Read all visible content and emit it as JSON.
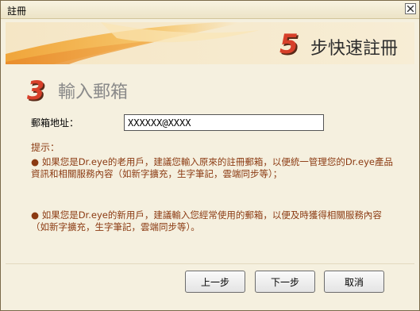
{
  "window": {
    "title": "註冊",
    "close_icon": "close-icon"
  },
  "banner": {
    "step_number": "5",
    "step_text": "步快速註冊"
  },
  "section": {
    "number": "3",
    "title": "輸入郵箱"
  },
  "form": {
    "email_label": "郵箱地址：",
    "email_value": "XXXXXX@XXXX"
  },
  "hints": {
    "label": "提示：",
    "old_user": "● 如果您是Dr.eye的老用戶，建議您輸入原來的註冊郵箱，以便統一管理您的Dr.eye產品資訊和相關服務內容（如新字擴充，生字筆記，雲端同步等）；",
    "new_user": "● 如果您是Dr.eye的新用戶，建議輸入您經常使用的郵箱，以便及時獲得相關服務內容（如新字擴充，生字筆記，雲端同步等）。"
  },
  "buttons": {
    "prev": "上一步",
    "next": "下一步",
    "cancel": "取消"
  },
  "colors": {
    "accent_red": "#d7402a",
    "hint_text": "#8b3a12",
    "background": "#f5f0df"
  }
}
